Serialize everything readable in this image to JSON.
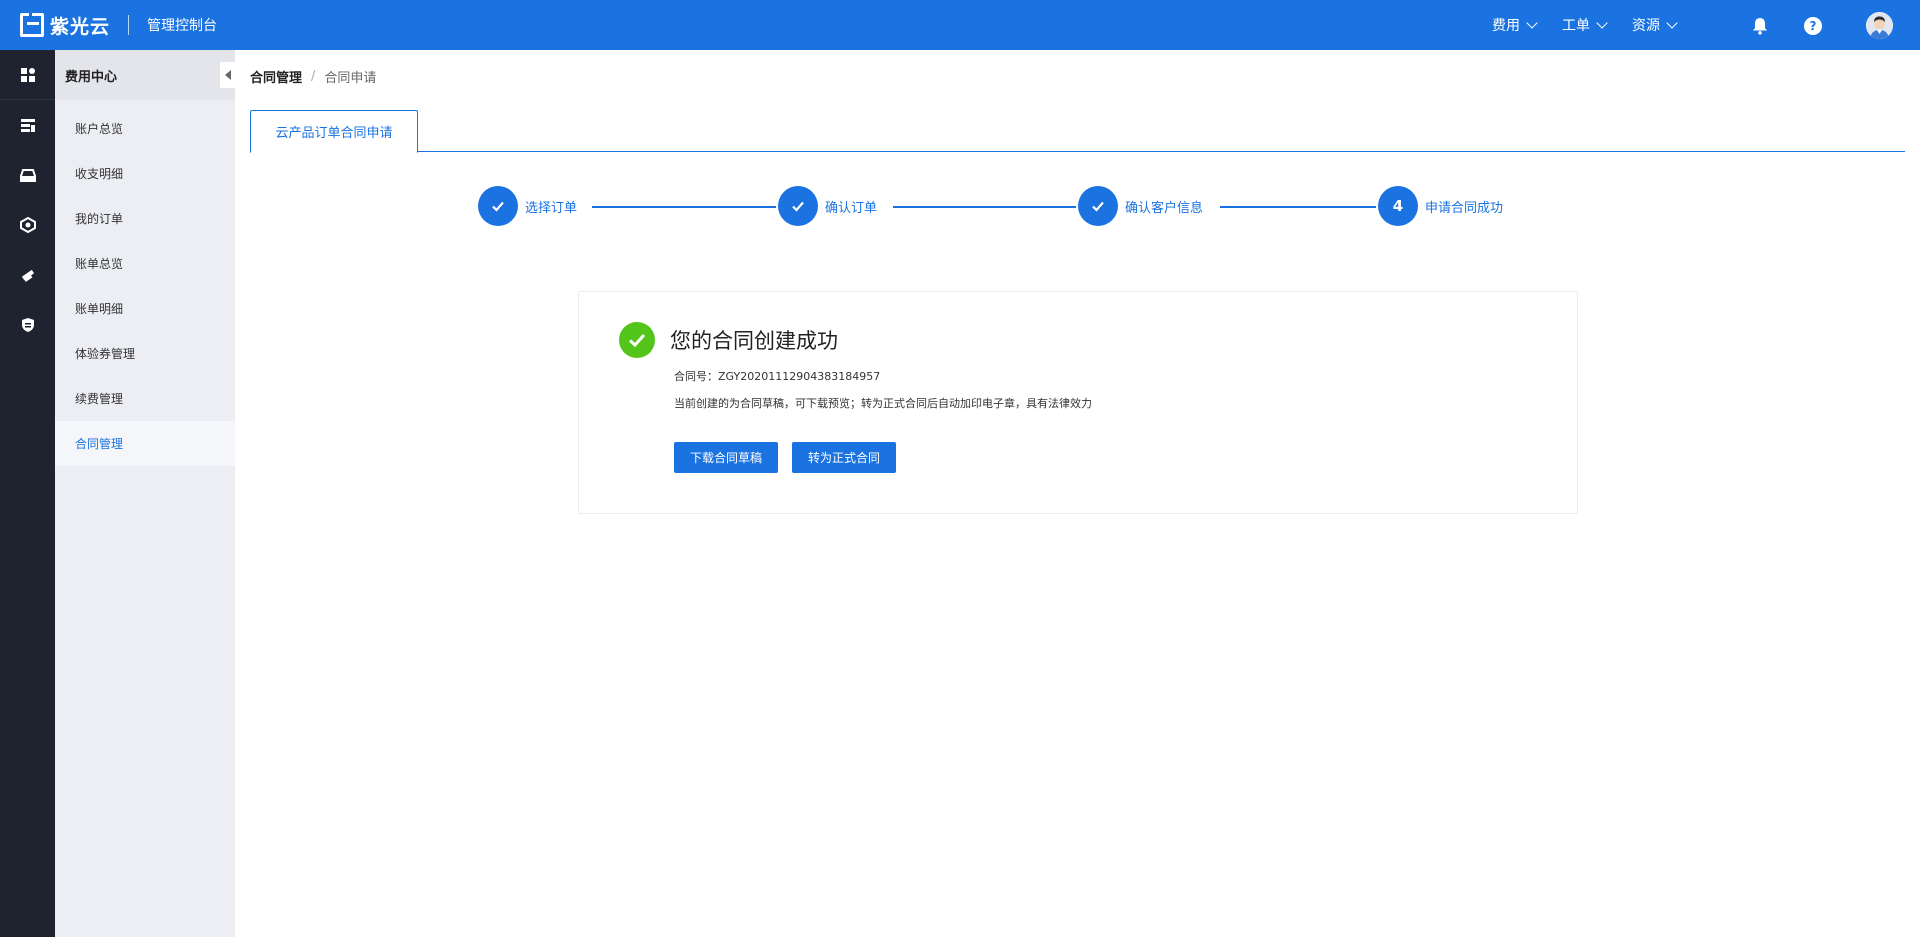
{
  "header": {
    "brand": "紫光云",
    "console_title": "管理控制台",
    "nav": [
      {
        "label": "费用"
      },
      {
        "label": "工单"
      },
      {
        "label": "资源"
      }
    ],
    "help_glyph": "?",
    "icons": [
      "bell-icon",
      "help-icon",
      "avatar"
    ]
  },
  "rail": {
    "icons": [
      "dashboard-icon",
      "server-list-icon",
      "storage-icon",
      "network-icon",
      "tools-icon",
      "security-shield-icon"
    ]
  },
  "sidebar": {
    "title": "费用中心",
    "items": [
      {
        "label": "账户总览"
      },
      {
        "label": "收支明细"
      },
      {
        "label": "我的订单"
      },
      {
        "label": "账单总览"
      },
      {
        "label": "账单明细"
      },
      {
        "label": "体验券管理"
      },
      {
        "label": "续费管理"
      },
      {
        "label": "合同管理"
      }
    ],
    "active_index": 7
  },
  "breadcrumb": {
    "parent": "合同管理",
    "separator": "/",
    "current": "合同申请"
  },
  "tabs": [
    {
      "label": "云产品订单合同申请"
    }
  ],
  "steps": [
    {
      "label": "选择订单",
      "state": "done"
    },
    {
      "label": "确认订单",
      "state": "done"
    },
    {
      "label": "确认客户信息",
      "state": "done"
    },
    {
      "label": "申请合同成功",
      "number": "4",
      "state": "current"
    }
  ],
  "result": {
    "title": "您的合同创建成功",
    "contract_no": "合同号：ZGY20201112904383184957",
    "description": "当前创建的为合同草稿，可下载预览；转为正式合同后自动加印电子章，具有法律效力",
    "download_label": "下载合同草稿",
    "convert_label": "转为正式合同"
  },
  "colors": {
    "primary": "#1a73e0",
    "success": "#52c41a",
    "rail_bg": "#1f2330",
    "sidebar_bg": "#eceef3"
  }
}
